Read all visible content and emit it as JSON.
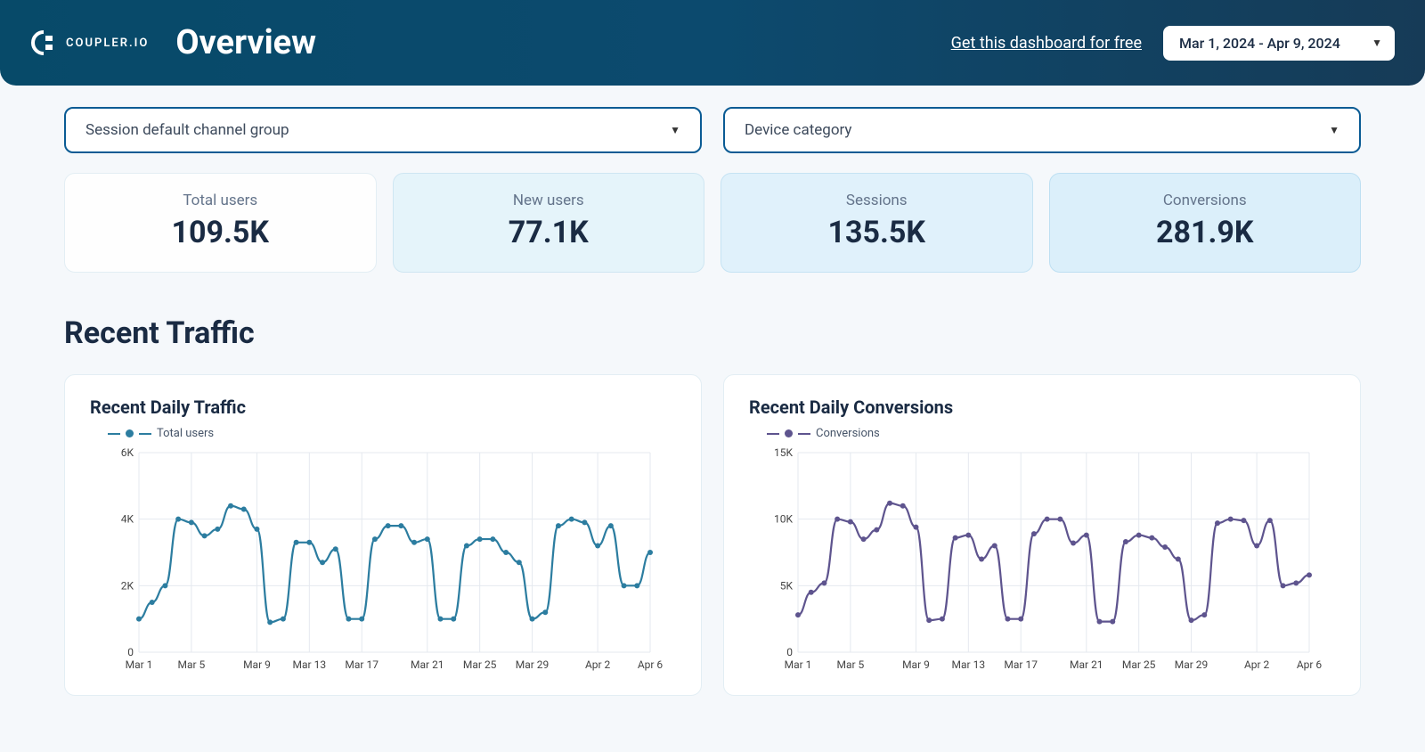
{
  "header": {
    "brand": "COUPLER.IO",
    "title": "Overview",
    "cta_link": "Get this dashboard for free",
    "date_range": "Mar 1, 2024 - Apr 9, 2024"
  },
  "filters": {
    "left": "Session default channel group",
    "right": "Device category"
  },
  "metrics": [
    {
      "label": "Total users",
      "value": "109.5K"
    },
    {
      "label": "New users",
      "value": "77.1K"
    },
    {
      "label": "Sessions",
      "value": "135.5K"
    },
    {
      "label": "Conversions",
      "value": "281.9K"
    }
  ],
  "section_title": "Recent Traffic",
  "charts": {
    "left": {
      "title": "Recent Daily Traffic",
      "legend": "Total users"
    },
    "right": {
      "title": "Recent Daily Conversions",
      "legend": "Conversions"
    }
  },
  "chart_data": [
    {
      "type": "line",
      "title": "Recent Daily Traffic",
      "legend": "Total users",
      "ylabel": "",
      "xlabel": "",
      "ylim": [
        0,
        6000
      ],
      "yticks": [
        0,
        2000,
        4000,
        6000
      ],
      "ytick_labels": [
        "0",
        "2K",
        "4K",
        "6K"
      ],
      "xtick_labels": [
        "Mar 1",
        "Mar 5",
        "Mar 9",
        "Mar 13",
        "Mar 17",
        "Mar 21",
        "Mar 25",
        "Mar 29",
        "Apr 2",
        "Apr 6"
      ],
      "color": "#2c7da0",
      "series": [
        {
          "name": "Total users",
          "x_index": [
            0,
            1,
            2,
            3,
            4,
            5,
            6,
            7,
            8,
            9,
            10,
            11,
            12,
            13,
            14,
            15,
            16,
            17,
            18,
            19,
            20,
            21,
            22,
            23,
            24,
            25,
            26,
            27,
            28,
            29,
            30,
            31,
            32,
            33,
            34,
            35,
            36,
            37,
            38,
            39
          ],
          "values": [
            1000,
            1500,
            2000,
            4000,
            3900,
            3500,
            3700,
            4400,
            4300,
            3700,
            900,
            1000,
            3300,
            3300,
            2700,
            3100,
            1000,
            1000,
            3400,
            3800,
            3800,
            3300,
            3400,
            1000,
            1000,
            3200,
            3400,
            3400,
            3000,
            2700,
            1000,
            1200,
            3800,
            4000,
            3900,
            3200,
            3800,
            2000,
            2000,
            3000
          ]
        }
      ]
    },
    {
      "type": "line",
      "title": "Recent Daily Conversions",
      "legend": "Conversions",
      "ylabel": "",
      "xlabel": "",
      "ylim": [
        0,
        15000
      ],
      "yticks": [
        0,
        5000,
        10000,
        15000
      ],
      "ytick_labels": [
        "0",
        "5K",
        "10K",
        "15K"
      ],
      "xtick_labels": [
        "Mar 1",
        "Mar 5",
        "Mar 9",
        "Mar 13",
        "Mar 17",
        "Mar 21",
        "Mar 25",
        "Mar 29",
        "Apr 2",
        "Apr 6"
      ],
      "color": "#5e548e",
      "series": [
        {
          "name": "Conversions",
          "x_index": [
            0,
            1,
            2,
            3,
            4,
            5,
            6,
            7,
            8,
            9,
            10,
            11,
            12,
            13,
            14,
            15,
            16,
            17,
            18,
            19,
            20,
            21,
            22,
            23,
            24,
            25,
            26,
            27,
            28,
            29,
            30,
            31,
            32,
            33,
            34,
            35,
            36,
            37,
            38,
            39
          ],
          "values": [
            2800,
            4500,
            5200,
            10000,
            9800,
            8500,
            9200,
            11200,
            11000,
            9400,
            2400,
            2500,
            8600,
            8800,
            7000,
            8000,
            2500,
            2500,
            8900,
            10000,
            10000,
            8200,
            8800,
            2300,
            2300,
            8300,
            8800,
            8600,
            7900,
            7000,
            2400,
            2800,
            9700,
            10000,
            9900,
            8000,
            9900,
            5000,
            5200,
            5800
          ]
        }
      ]
    }
  ]
}
